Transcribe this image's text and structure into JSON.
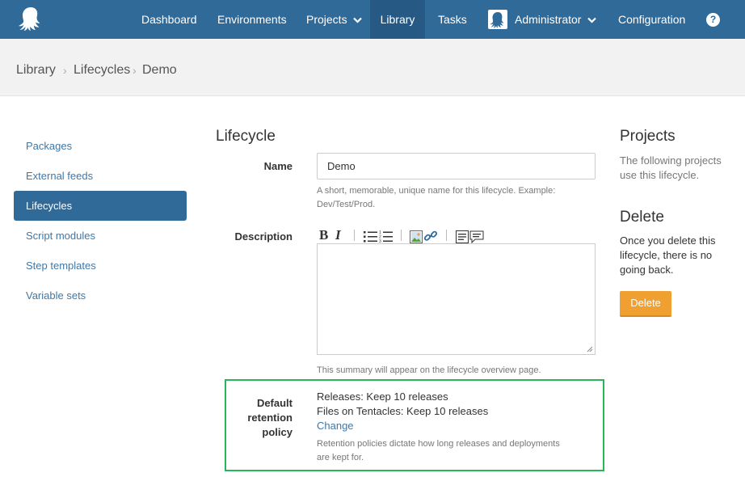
{
  "nav": {
    "items": [
      {
        "label": "Dashboard"
      },
      {
        "label": "Environments"
      },
      {
        "label": "Projects"
      },
      {
        "label": "Library"
      },
      {
        "label": "Tasks"
      },
      {
        "label": "Administrator"
      },
      {
        "label": "Configuration"
      }
    ],
    "help_label": "?",
    "accent": "#2f6a98"
  },
  "breadcrumb": [
    "Library",
    "Lifecycles",
    "Demo"
  ],
  "sidebar": {
    "items": [
      {
        "label": "Packages"
      },
      {
        "label": "External feeds"
      },
      {
        "label": "Lifecycles",
        "active": true
      },
      {
        "label": "Script modules"
      },
      {
        "label": "Step templates"
      },
      {
        "label": "Variable sets"
      }
    ]
  },
  "form": {
    "heading": "Lifecycle",
    "name_label": "Name",
    "name_value": "Demo",
    "name_help_1": "A short, memorable, unique name for this lifecycle. Example:",
    "name_help_2": "Dev/Test/Prod.",
    "description_label": "Description",
    "description_value": "",
    "description_help": "This summary will appear on the lifecycle overview page.",
    "toolbar": {
      "bold": "B",
      "italic": "I"
    },
    "retention": {
      "label_1": "Default",
      "label_2": "retention",
      "label_3": "policy",
      "releases": "Releases: Keep 10 releases",
      "tentacles": "Files on Tentacles: Keep 10 releases",
      "change_link": "Change",
      "help_1": "Retention policies dictate how long releases and deployments",
      "help_2": "are kept for."
    }
  },
  "right": {
    "projects_heading": "Projects",
    "projects_text_1": "The following projects",
    "projects_text_2": "use this lifecycle.",
    "delete_heading": "Delete",
    "delete_text_1": "Once you delete this",
    "delete_text_2": "lifecycle, there is no",
    "delete_text_3": "going back.",
    "delete_button": "Delete",
    "delete_color": "#f0a030"
  }
}
